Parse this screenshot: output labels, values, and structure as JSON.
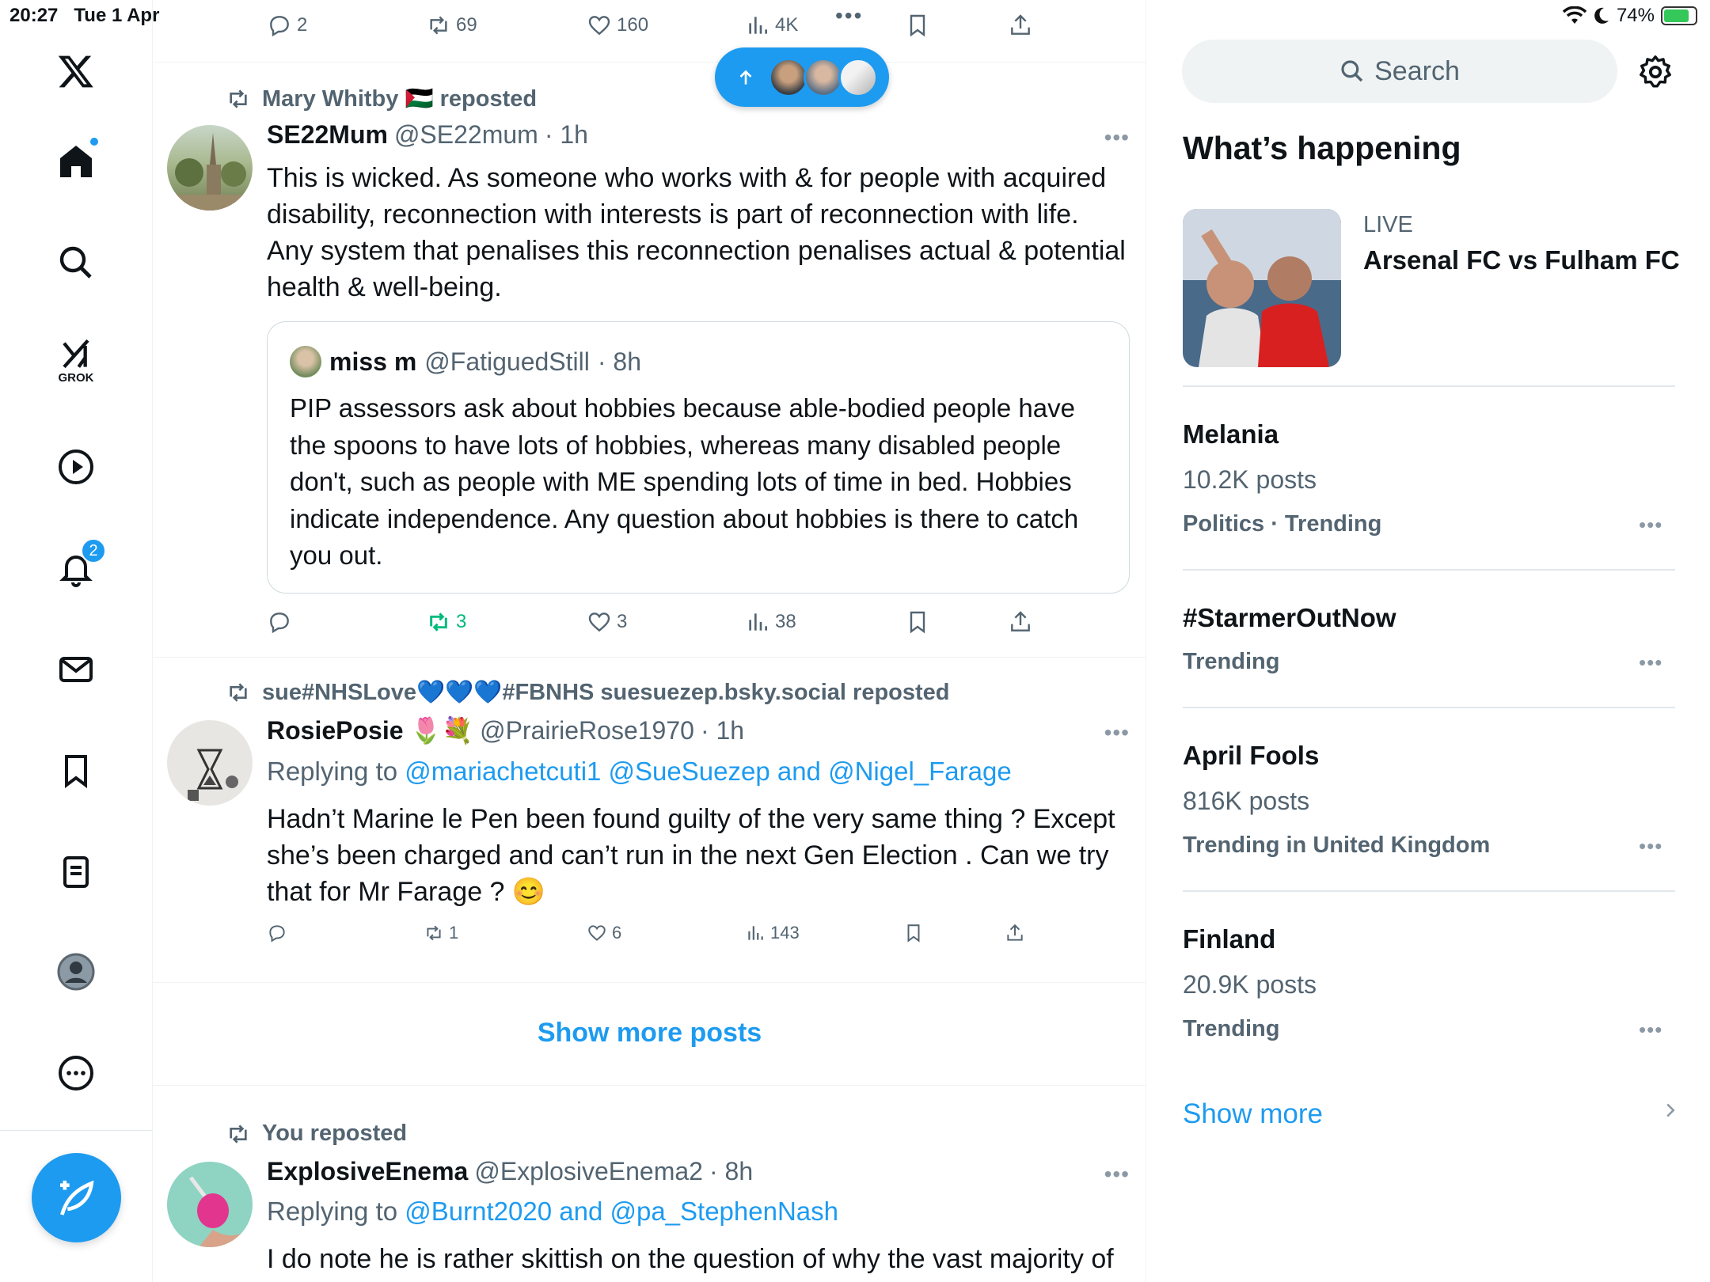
{
  "status_bar": {
    "time": "20:27",
    "date": "Tue 1 Apr",
    "battery": "74%"
  },
  "nav": {
    "notifications_count": "2",
    "grok_label": "GROK"
  },
  "feed": {
    "top_actions": {
      "replies": "2",
      "reposts": "69",
      "likes": "160",
      "views": "4K"
    },
    "post1": {
      "repost_by": "Mary Whitby 🇵🇸 reposted",
      "name": "SE22Mum",
      "handle": "@SE22mum",
      "time": "· 1h",
      "text": "This is wicked. As someone who works with & for people with acquired disability, reconnection with interests is part of reconnection with life. Any system that penalises this reconnection penalises actual & potential health & well-being.",
      "quote": {
        "name": "miss m",
        "handle": "@FatiguedStill",
        "time": "· 8h",
        "text": "PIP assessors ask about hobbies because able-bodied people have the spoons to have lots of hobbies, whereas many disabled people don't, such as people with ME spending lots of time in bed. Hobbies indicate independence. Any question about hobbies is there to catch you out."
      },
      "actions": {
        "replies": "",
        "reposts": "3",
        "likes": "3",
        "views": "38"
      }
    },
    "post2": {
      "repost_by": "sue#NHSLove💙💙💙#FBNHS suesuezep.bsky.social reposted",
      "name": "RosiePosie 🌷💐",
      "handle": "@PrairieRose1970",
      "time": "· 1h",
      "replying_prefix": "Replying to",
      "replying_to": "@mariachetcuti1 @SueSuezep and @Nigel_Farage",
      "text": "Hadn’t Marine le Pen been found guilty of the very same thing ? Except she’s been charged and can’t run in the next Gen Election . Can we try that for Mr Farage ? 😊",
      "actions": {
        "replies": "",
        "reposts": "1",
        "likes": "6",
        "views": "143"
      }
    },
    "show_more_posts": "Show more posts",
    "post3": {
      "repost_by": "You reposted",
      "name": "ExplosiveEnema",
      "handle": "@ExplosiveEnema2",
      "time": "· 8h",
      "replying_prefix": "Replying to",
      "replying_to": "@Burnt2020 and @pa_StephenNash",
      "text": "I do note he is rather skittish on the question of why the vast majority of"
    },
    "more_dots": "•••"
  },
  "right": {
    "search_placeholder": "Search",
    "whats_happening": "What’s happening",
    "live_label": "LIVE",
    "live_title": "Arsenal FC vs Fulham FC",
    "trends": [
      {
        "name": "Melania",
        "posts": "10.2K posts",
        "category": "Politics · Trending"
      },
      {
        "name": "#StarmerOutNow",
        "posts": "",
        "category": "Trending"
      },
      {
        "name": "April Fools",
        "posts": "816K posts",
        "category": "Trending in United Kingdom"
      },
      {
        "name": "Finland",
        "posts": "20.9K posts",
        "category": "Trending"
      }
    ],
    "show_more": "Show more",
    "more_dots": "•••"
  },
  "colors": {
    "accent": "#1d9bf0",
    "repost_active": "#00ba7c",
    "muted": "#536471"
  }
}
